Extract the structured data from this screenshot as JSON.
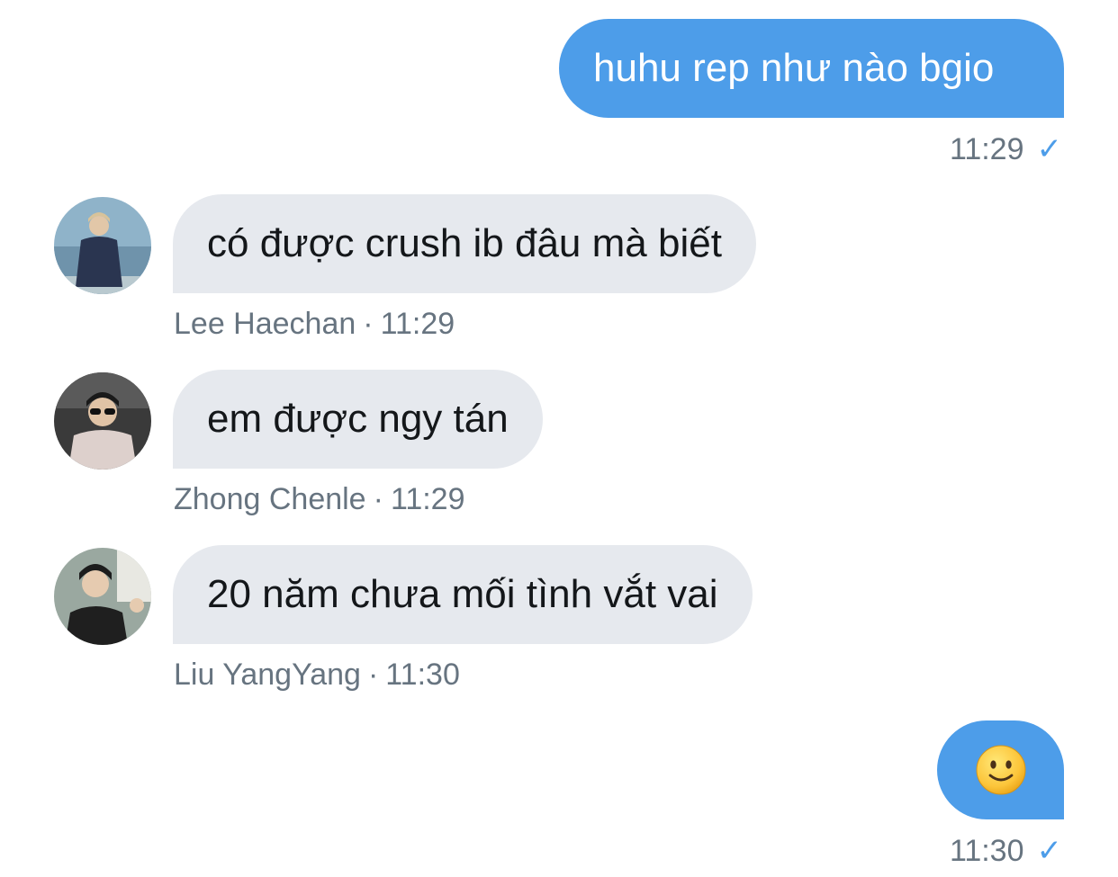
{
  "messages": [
    {
      "direction": "outgoing",
      "text": "huhu rep như nào bgio",
      "time": "11:29",
      "status_icon": "check-icon"
    },
    {
      "direction": "incoming",
      "sender": "Lee Haechan",
      "text": "có được crush ib đâu mà biết",
      "time": "11:29",
      "separator": "·",
      "avatar_icon": "avatar-photo"
    },
    {
      "direction": "incoming",
      "sender": "Zhong Chenle",
      "text": "em được ngy tán",
      "time": "11:29",
      "separator": "·",
      "avatar_icon": "avatar-photo"
    },
    {
      "direction": "incoming",
      "sender": "Liu YangYang",
      "text": "20 năm chưa mối tình vắt vai",
      "time": "11:30",
      "separator": "·",
      "avatar_icon": "avatar-photo"
    },
    {
      "direction": "outgoing",
      "emoji": "slightly-smiling-face",
      "time": "11:30",
      "status_icon": "check-icon"
    }
  ],
  "colors": {
    "outgoing_bubble": "#4d9de9",
    "incoming_bubble": "#e6e9ee",
    "meta_text": "#677480",
    "check": "#4d9de9"
  }
}
